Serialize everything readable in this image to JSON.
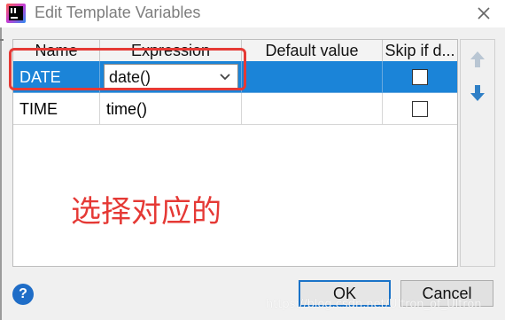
{
  "window": {
    "title": "Edit Template Variables",
    "close_icon": "close-icon",
    "app_icon": "intellij-app-icon"
  },
  "table": {
    "columns": [
      "Name",
      "Expression",
      "Default value",
      "Skip if d..."
    ],
    "rows": [
      {
        "name": "DATE",
        "expression": "date()",
        "default_value": "",
        "skip_if_defined": false,
        "selected": true,
        "editing_expression": true
      },
      {
        "name": "TIME",
        "expression": "time()",
        "default_value": "",
        "skip_if_defined": false,
        "selected": false,
        "editing_expression": false
      }
    ],
    "selected_row_color": "#1b84d8"
  },
  "toolbar": {
    "move_up_icon": "arrow-up-icon",
    "move_down_icon": "arrow-down-icon"
  },
  "annotation": {
    "text": "选择对应的",
    "color": "#e53935"
  },
  "footer": {
    "help_icon": "help-icon",
    "help_label": "?",
    "ok_label": "OK",
    "cancel_label": "Cancel"
  },
  "watermark": {
    "text": "https://blog.csdn.net/Ultron_of_Ultron"
  }
}
